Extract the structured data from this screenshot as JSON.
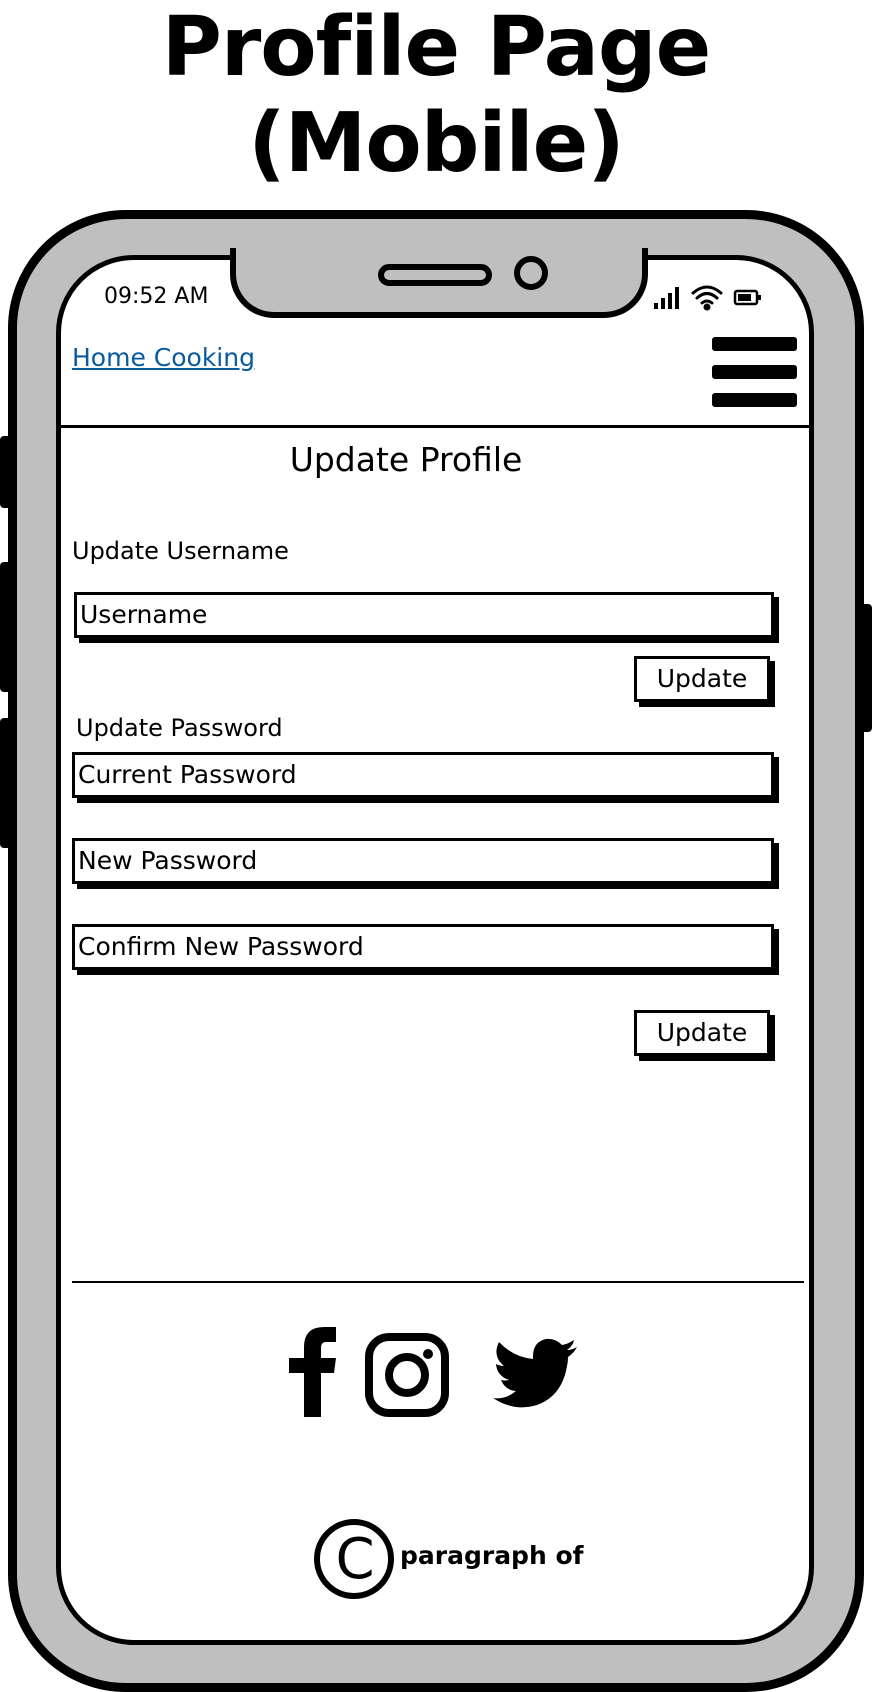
{
  "page": {
    "title": "Profile Page (Mobile)"
  },
  "status_bar": {
    "time": "09:52 AM"
  },
  "header": {
    "brand_link": "Home Cooking"
  },
  "main": {
    "title": "Update Profile",
    "username_section": {
      "label": "Update Username",
      "username_placeholder": "Username",
      "button_label": "Update"
    },
    "password_section": {
      "label": "Update Password",
      "current_placeholder": "Current Password",
      "new_placeholder": "New Password",
      "confirm_placeholder": "Confirm New Password",
      "button_label": "Update"
    }
  },
  "footer": {
    "social_icons": [
      "facebook-icon",
      "instagram-icon",
      "twitter-icon"
    ],
    "copyright_symbol": "C",
    "copyright_text": "paragraph of"
  }
}
